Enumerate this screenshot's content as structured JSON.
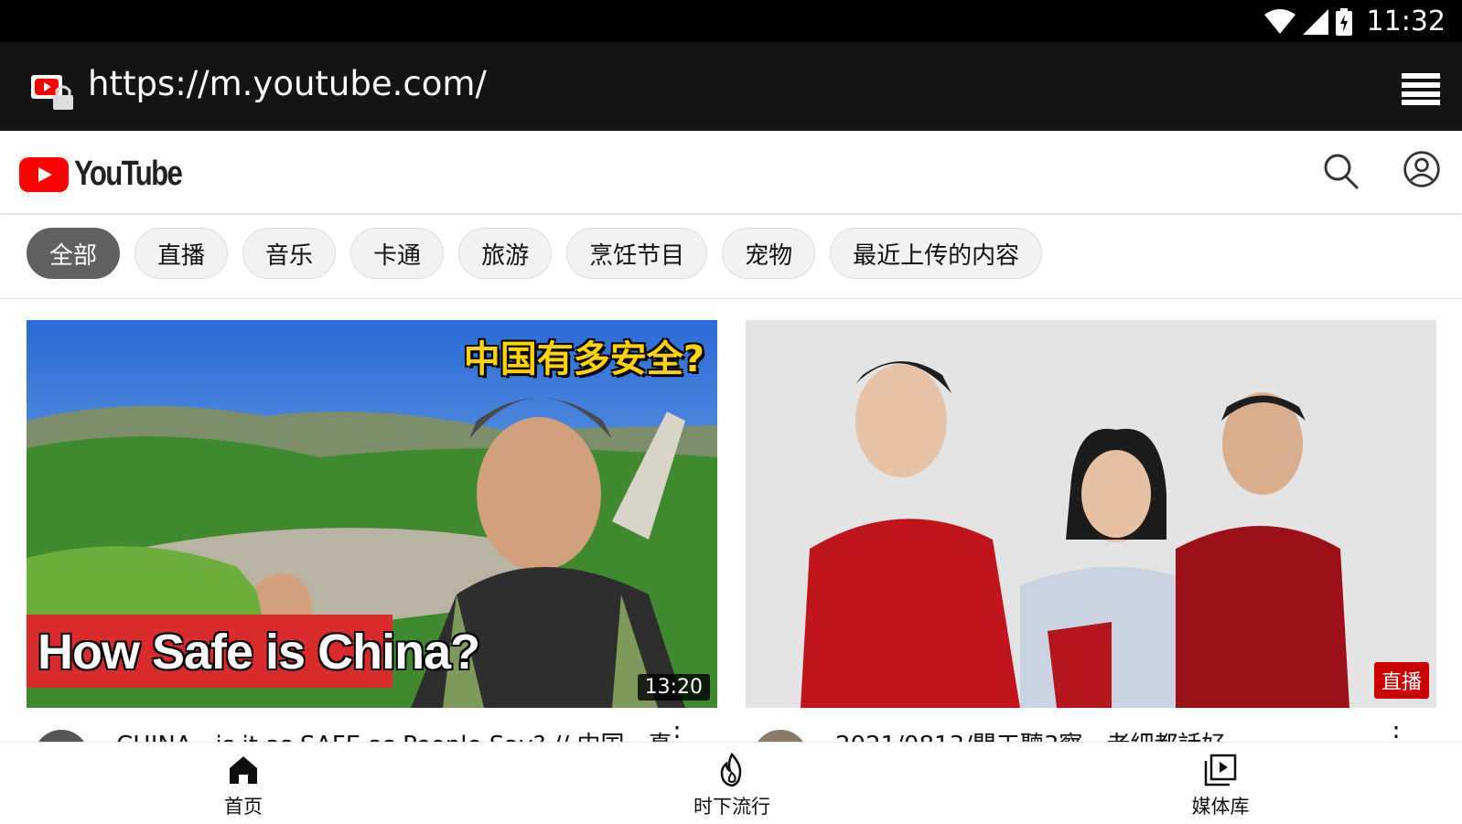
{
  "status_bar": {
    "time": "11:32",
    "icons": [
      "wifi-icon",
      "cell-signal-icon",
      "battery-charging-icon"
    ]
  },
  "browser": {
    "url": "https://m.youtube.com/",
    "site_icon": "youtube-lock-icon",
    "menu_icon": "tabs-menu-icon"
  },
  "header": {
    "brand": "YouTube",
    "search_icon": "search-icon",
    "account_icon": "account-icon"
  },
  "chips": [
    {
      "label": "全部",
      "active": true
    },
    {
      "label": "直播"
    },
    {
      "label": "音乐"
    },
    {
      "label": "卡通"
    },
    {
      "label": "旅游"
    },
    {
      "label": "烹饪节目"
    },
    {
      "label": "宠物"
    },
    {
      "label": "最近上传的内容"
    }
  ],
  "videos": [
    {
      "thumb_title": "How Safe is China?",
      "thumb_caption": "中国有多安全?",
      "duration": "13:20",
      "title": "CHINA - is it as SAFE as People Say? // 中国，真"
    },
    {
      "badge": "直播",
      "title": "2021/0813/閒工聽3察，老細都話好"
    }
  ],
  "bottom_nav": [
    {
      "label": "首页",
      "icon": "home-icon"
    },
    {
      "label": "时下流行",
      "icon": "trending-fire-icon"
    },
    {
      "label": "媒体库",
      "icon": "library-icon"
    }
  ],
  "colors": {
    "brand_red": "#ff0000",
    "live_red": "#cc0000",
    "active_chip": "#606060"
  }
}
